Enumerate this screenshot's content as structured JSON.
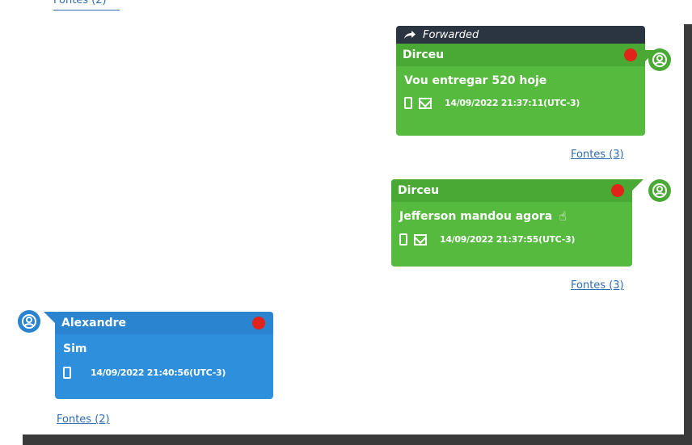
{
  "top_link": "Fontes (2)",
  "messages": [
    {
      "forwarded_label": "Forwarded",
      "sender": "Dirceu",
      "text": "Vou entregar 520 hoje",
      "timestamp": "14/09/2022 21:37:11(UTC-3)",
      "sources": "Fontes (3)",
      "side": "right",
      "color": "#56ba3f"
    },
    {
      "sender": "Dirceu",
      "text": "Jefferson mandou agora",
      "timestamp": "14/09/2022 21:37:55(UTC-3)",
      "sources": "Fontes (3)",
      "side": "right",
      "color": "#56ba3f"
    },
    {
      "sender": "Alexandre",
      "text": "Sim",
      "timestamp": "14/09/2022 21:40:56(UTC-3)",
      "sources": "Fontes (2)",
      "side": "left",
      "color": "#2e8fdc"
    }
  ],
  "colors": {
    "green": "#56ba3f",
    "blue": "#2e8fdc",
    "status_dot": "#e2231a",
    "forward_bar": "#2b3441",
    "link": "#2f6db5"
  },
  "icons": [
    "forward-arrow-icon",
    "status-dot-icon",
    "phone-icon",
    "mail-icon",
    "hand-pointer-icon",
    "user-avatar-icon"
  ]
}
